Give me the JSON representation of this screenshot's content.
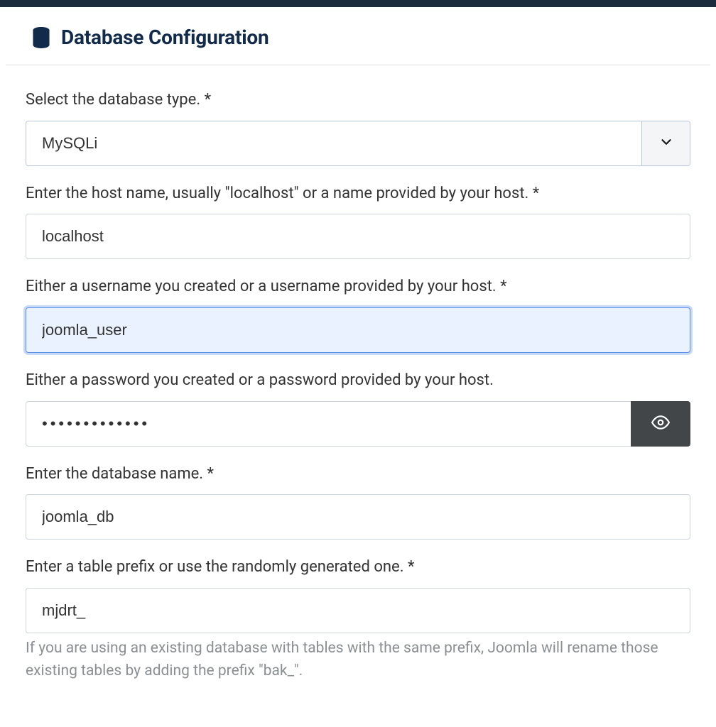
{
  "header": {
    "title": "Database Configuration"
  },
  "fields": {
    "dbtype": {
      "label": "Select the database type. *",
      "value": "MySQLi"
    },
    "host": {
      "label": "Enter the host name, usually \"localhost\" or a name provided by your host. *",
      "value": "localhost"
    },
    "username": {
      "label": "Either a username you created or a username provided by your host. *",
      "value": "joomla_user"
    },
    "password": {
      "label": "Either a password you created or a password provided by your host.",
      "value": "•••••••••••••"
    },
    "dbname": {
      "label": "Enter the database name. *",
      "value": "joomla_db"
    },
    "prefix": {
      "label": "Enter a table prefix or use the randomly generated one. *",
      "value": "mjdrt_",
      "help": "If you are using an existing database with tables with the same prefix, Joomla will rename those existing tables by adding the prefix \"bak_\"."
    }
  }
}
